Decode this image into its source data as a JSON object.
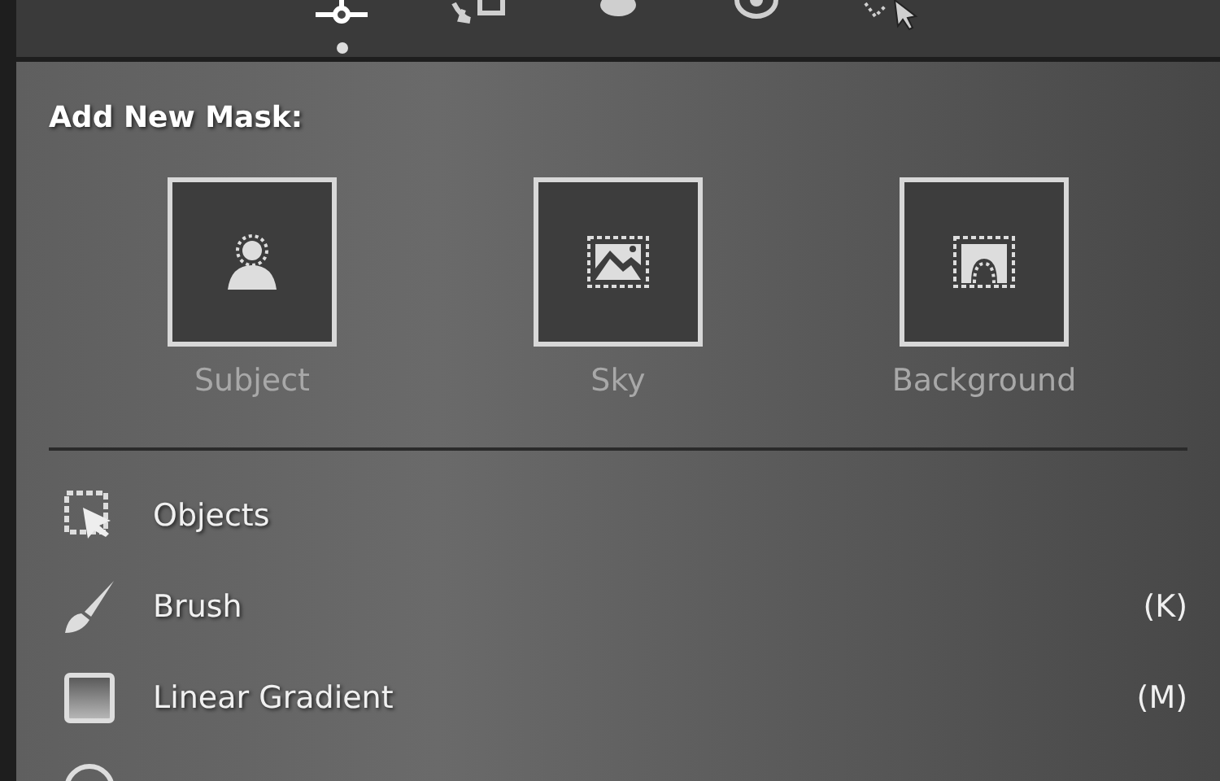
{
  "toolbar": {
    "tools": [
      {
        "kind": "sliders",
        "selected": true
      },
      {
        "kind": "crop",
        "selected": false
      },
      {
        "kind": "heal",
        "selected": false
      },
      {
        "kind": "eye",
        "selected": false
      },
      {
        "kind": "mask",
        "selected": false
      }
    ]
  },
  "add_new_mask": {
    "heading": "Add New Mask:",
    "options": [
      {
        "kind": "subject",
        "label": "Subject"
      },
      {
        "kind": "sky",
        "label": "Sky"
      },
      {
        "kind": "background",
        "label": "Background"
      }
    ]
  },
  "tools": [
    {
      "kind": "objects",
      "label": "Objects"
    },
    {
      "kind": "brush",
      "label": "Brush",
      "shortcut": "(K)"
    },
    {
      "kind": "linear",
      "label": "Linear Gradient",
      "shortcut": "(M)"
    },
    {
      "kind": "radial"
    }
  ]
}
